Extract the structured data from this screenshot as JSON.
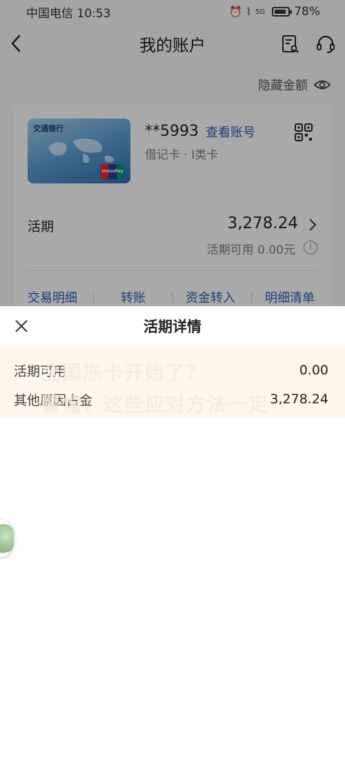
{
  "status_bar": {
    "carrier_time": "中国电信 10:53",
    "battery": "78%",
    "signal_label": "5G"
  },
  "nav": {
    "title": "我的账户"
  },
  "account": {
    "hide_amount_label": "隐藏金额",
    "bank_logo_text": "交通银行",
    "unionpay_label": "UnionPay 银联",
    "card_number": "**5993",
    "view_account_label": "查看账号",
    "card_type": "借记卡 · I类卡",
    "current_label": "活期",
    "current_amount": "3,278.24",
    "available_text": "活期可用 0.00元",
    "info_glyph": "i"
  },
  "quick_actions": [
    {
      "label": "交易明细"
    },
    {
      "label": "转账"
    },
    {
      "label": "资金转入"
    },
    {
      "label": "明细清单"
    }
  ],
  "sheet": {
    "title": "活期详情",
    "rows": [
      {
        "label": "活期可用",
        "value": "0.00"
      },
      {
        "label": "其他原因占金",
        "value": "3,278.24"
      }
    ],
    "watermark_line1": "全国冻卡开始了？",
    "watermark_line2": "警惕：这些应对方法一定"
  },
  "colors": {
    "link_blue": "#2a5caa",
    "sheet_highlight": "#fdf6ea"
  }
}
